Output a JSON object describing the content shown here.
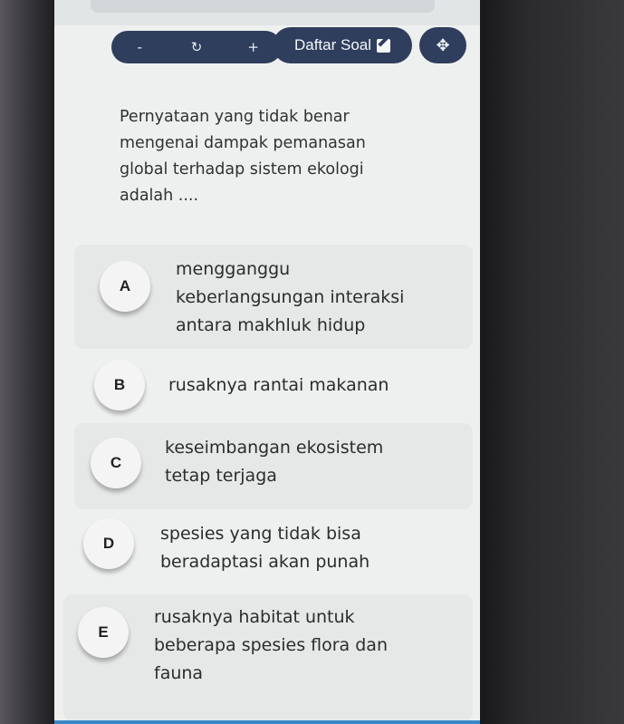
{
  "toolbar": {
    "minus_label": "-",
    "refresh_icon": "↻",
    "plus_label": "+",
    "daftar_soal_label": "Daftar Soal",
    "move_icon": "✥"
  },
  "question": {
    "text": "Pernyataan yang tidak benar\nmengenai dampak pemanasan\nglobal terhadap sistem ekologi\nadalah ...."
  },
  "options": [
    {
      "letter": "A",
      "text": "mengganggu\nkeberlangsungan interaksi\nantara makhluk hidup"
    },
    {
      "letter": "B",
      "text": "rusaknya rantai makanan"
    },
    {
      "letter": "C",
      "text": "keseimbangan ekosistem\ntetap terjaga"
    },
    {
      "letter": "D",
      "text": "spesies yang tidak bisa\nberadaptasi akan punah"
    },
    {
      "letter": "E",
      "text": "rusaknya habitat untuk\nbeberapa spesies flora dan\nfauna"
    }
  ],
  "colors": {
    "toolbar_bg": "#2e3e5c",
    "screen_bg": "#eef0ef",
    "option_bg": "#e6e8e7"
  }
}
